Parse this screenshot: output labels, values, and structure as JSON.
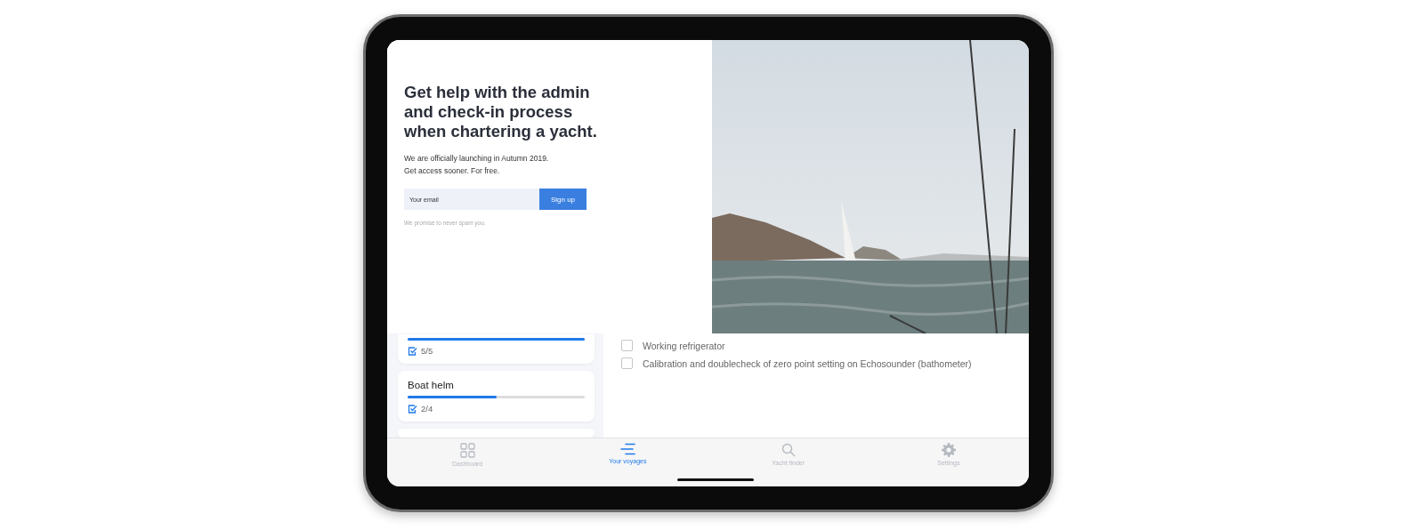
{
  "signup_panel": {
    "heading": "Get help with the admin and check-in process when chartering a yacht.",
    "body_lines": [
      "We are officially launching in Autumn 2019.",
      "Get access sooner. For free."
    ],
    "email_field": {
      "placeholder": "Your email"
    },
    "button": "Sign up",
    "note": "We promise to never spam you."
  },
  "sidebar": {
    "cards": [
      {
        "level": 1,
        "count": "5/5"
      },
      {
        "title": "Boat helm",
        "level": 0.5,
        "count": "2/4"
      }
    ]
  },
  "checklist": [
    {
      "label": "Working refrigerator",
      "checked": false
    },
    {
      "label": "Calibration and doublecheck of zero point setting on Echosounder (bathometer)",
      "checked": false
    }
  ],
  "tab_bar": [
    {
      "label": "Dashboard",
      "selected": false
    },
    {
      "label": "Your voyages",
      "selected": true
    },
    {
      "label": "Yacht finder",
      "selected": false
    },
    {
      "label": "Settings",
      "selected": false
    }
  ]
}
